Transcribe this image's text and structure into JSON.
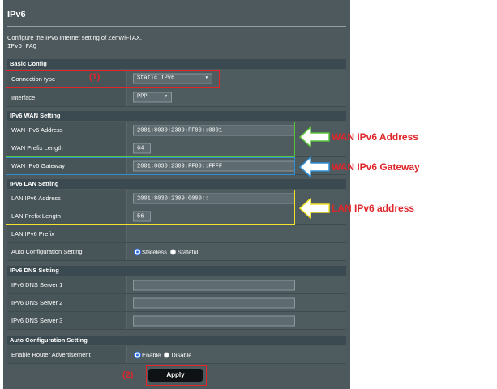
{
  "page": {
    "title": "IPv6",
    "description": "Configure the IPv6 Internet setting of ZenWiFi AX.",
    "faq_link": "IPv6 FAQ"
  },
  "sections": {
    "basic": "Basic Config",
    "wan": "IPv6 WAN Setting",
    "lan": "IPv6 LAN Setting",
    "dns": "IPv6 DNS Setting",
    "auto": "Auto Configuration Setting"
  },
  "fields": {
    "connection_type": {
      "label": "Connection type",
      "value": "Static IPv6"
    },
    "interface": {
      "label": "Interface",
      "value": "PPP"
    },
    "wan_address": {
      "label": "WAN IPv6 Address",
      "value": "2001:8030:2309:FF00::0001"
    },
    "wan_prefix": {
      "label": "WAN Prefix Length",
      "value": "64"
    },
    "wan_gateway": {
      "label": "WAN IPv6 Gateway",
      "value": "2001:8030:2309:FF00::FFFF"
    },
    "lan_address": {
      "label": "LAN IPv6 Address",
      "value": "2001:8030:2309:0000::"
    },
    "lan_prefix": {
      "label": "LAN Prefix Length",
      "value": "56"
    },
    "lan_ipv6_prefix": {
      "label": "LAN IPv6 Prefix"
    },
    "auto_config": {
      "label": "Auto Configuration Setting",
      "option_stateless": "Stateless",
      "option_stateful": "Stateful"
    },
    "dns1": {
      "label": "IPv6 DNS Server 1",
      "value": ""
    },
    "dns2": {
      "label": "IPv6 DNS Server 2",
      "value": ""
    },
    "dns3": {
      "label": "IPv6 DNS Server 3",
      "value": ""
    },
    "router_adv": {
      "label": "Enable Router Advertisement",
      "option_enable": "Enable",
      "option_disable": "Disable"
    }
  },
  "buttons": {
    "apply": "Apply"
  },
  "annotations": {
    "marker_1": "(1)",
    "marker_2": "(2)",
    "wan_address": "WAN IPv6 Address",
    "wan_gateway": "WAN IPv6 Gateway",
    "lan_address": "LAN IPv6 address"
  },
  "colors": {
    "red": "#e0262a",
    "green": "#59c43a",
    "blue": "#2f8fd6",
    "yellow": "#f2e22b",
    "panel": "#4d595d"
  }
}
